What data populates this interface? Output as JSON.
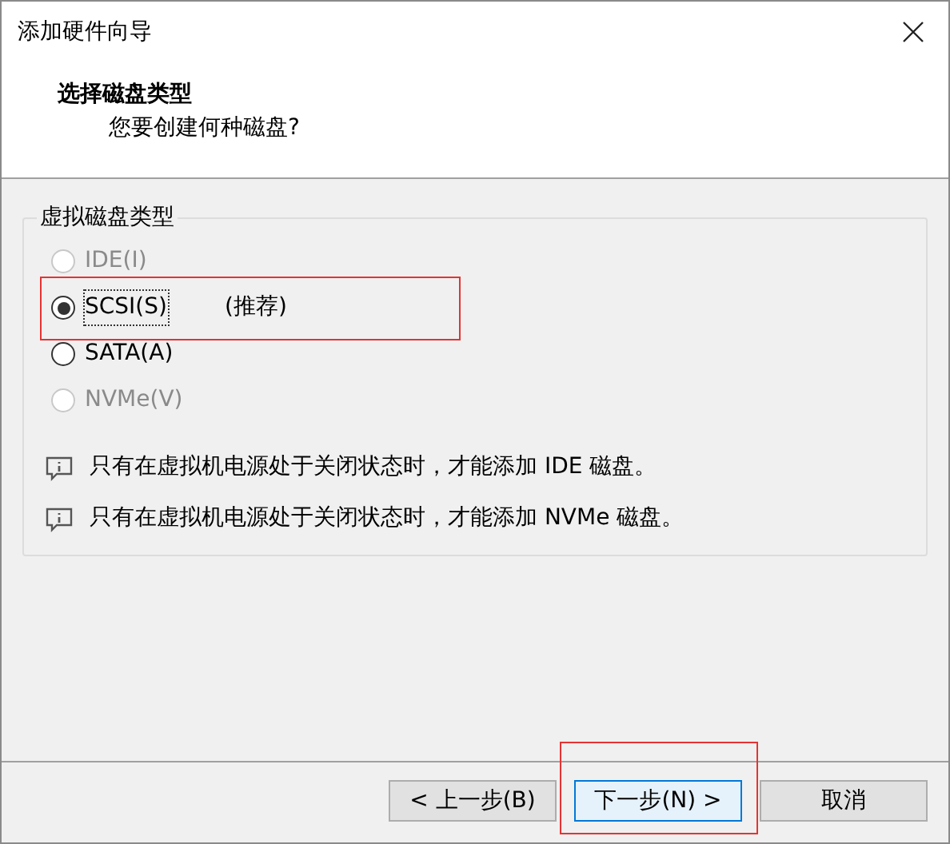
{
  "window": {
    "title": "添加硬件向导"
  },
  "header": {
    "title": "选择磁盘类型",
    "subtitle": "您要创建何种磁盘?"
  },
  "group": {
    "title": "虚拟磁盘类型",
    "options": [
      {
        "label": "IDE(I)",
        "selected": false,
        "disabled": true,
        "highlighted": false
      },
      {
        "label": "SCSI(S)",
        "note": "(推荐)",
        "selected": true,
        "disabled": false,
        "highlighted": true
      },
      {
        "label": "SATA(A)",
        "selected": false,
        "disabled": false,
        "highlighted": false
      },
      {
        "label": "NVMe(V)",
        "selected": false,
        "disabled": true,
        "highlighted": false
      }
    ],
    "notes": [
      "只有在虚拟机电源处于关闭状态时，才能添加 IDE 磁盘。",
      "只有在虚拟机电源处于关闭状态时，才能添加 NVMe 磁盘。"
    ]
  },
  "buttons": [
    {
      "label": "< 上一步(B)",
      "kind": "normal",
      "highlighted": false
    },
    {
      "label": "下一步(N) >",
      "kind": "default",
      "highlighted": true
    },
    {
      "label": "取消",
      "kind": "normal",
      "highlighted": false
    }
  ]
}
